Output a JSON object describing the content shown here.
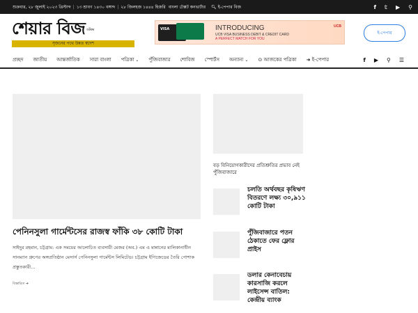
{
  "topbar": {
    "date_bn": "শুক্রবার, ২৮ জুলাই ২০২৩ খ্রিস্টাব্দ",
    "date_bangla": "১৩ শ্রাবণ ১৪৩০ বঙ্গাব্দ",
    "date_hijri": "২৮ জিলহজ ১৪৪৪ হিজরি",
    "links": [
      "বাংলা টেক্সট কনভার্টার"
    ],
    "search_label": "ই-পেপার বিজ",
    "social": [
      "facebook-icon",
      "twitter-icon",
      "youtube-icon",
      "search-icon"
    ]
  },
  "header": {
    "brand": "শেয়ার বিজ",
    "brand_small": "ডটকম",
    "tagline": "সৃজনের পথে উন্নত স্বদেশ",
    "ad": {
      "title": "INTRODUCING",
      "line2": "UCB VISA BUSINESS DEBIT & CREDIT CARD",
      "line3": "A PERFECT MATCH FOR YOU",
      "brand": "UCB",
      "card_brand": "VISA"
    },
    "epaper_button": "ই-পেপার"
  },
  "nav": {
    "items": [
      {
        "label": "প্রচ্ছদ",
        "dropdown": false
      },
      {
        "label": "জাতীয়",
        "dropdown": false
      },
      {
        "label": "আন্তর্জাতিক",
        "dropdown": false
      },
      {
        "label": "সারা বাংলা",
        "dropdown": false
      },
      {
        "label": "পত্রিকা",
        "dropdown": true
      },
      {
        "label": "পুঁজিবাজার",
        "dropdown": false
      },
      {
        "label": "শোবিজ",
        "dropdown": false
      },
      {
        "label": "স্পোর্টস",
        "dropdown": false
      },
      {
        "label": "অন্যান্য",
        "dropdown": true
      },
      {
        "label": "⊙ আজকের পত্রিকা",
        "dropdown": false
      },
      {
        "label": "➜ ই-পেপার",
        "dropdown": false
      }
    ],
    "right_icons": [
      "facebook-icon",
      "youtube-icon",
      "search-icon",
      "menu-icon"
    ]
  },
  "main": {
    "hero": {
      "title": "পেনিনসুলা গার্মেন্টসের রাজস্ব ফাঁকি ৩৮ কোটি টাকা",
      "excerpt": "সাইদুর রহমান, চট্টগ্রাম: এক সময়ের আলোচিত ব্যবসায়ী মেজর (অব.) এম এ মান্নানের মালিকানাধীন সানম্যান গ্রুপের অঙ্গপ্রতিষ্ঠান মেসার্স পেনিনসুলা গার্মেন্টস লিমিটেড। চট্টগ্রাম ইপিজেডের তৈরি পোশাক প্রস্তুতকারী...",
      "read_more": "বিস্তারিত ➜"
    },
    "side_feature": {
      "caption": "বড় বিনিয়োগকারীদের প্রতিশ্রুতির প্রভাব নেই পুঁজিবাজারে"
    },
    "side_list": [
      {
        "title": "চলতি অর্থবছর কৃষিঋণ বিতরণে লক্ষ্য ৩০,৯১১ কোটি টাকা"
      },
      {
        "title": "পুঁজিবাজারে পতন ঠেকাতে ফের ফ্লোর প্রাইস"
      },
      {
        "title": "ডলার কেনাবেচায় কারসাজি করলে লাইসেন্স বাতিল: কেন্দ্রীয় ব্যাংক"
      }
    ]
  }
}
